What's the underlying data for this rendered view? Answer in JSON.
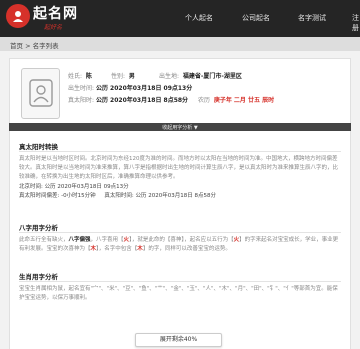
{
  "header": {
    "logo_title": "起名网",
    "logo_sub": "起好名",
    "nav": [
      "个人起名",
      "公司起名",
      "名字测试",
      "注册"
    ]
  },
  "breadcrumb": "首页 > 名字列表",
  "profile": {
    "surname_label": "姓氏:",
    "surname": "陈",
    "gender_label": "性别:",
    "gender": "男",
    "birthplace_label": "出生地:",
    "birthplace": "福建省-厦门市-湖里区",
    "birth_label": "出生时间:",
    "birth_value": "公历 2020年03月18日 09点13分",
    "true_solar_label": "真太阳时:",
    "true_solar_value": "公历 2020年03月18日 8点58分",
    "lunar_label": "农历",
    "lunar_value": "庚子年 二月 廿五 辰时"
  },
  "collapse_label": "收起用字分析 ▼",
  "sections": {
    "s1_title": "真太阳时转换",
    "s1_text": "真太阳时是以当地时区时间。北京时间为东经120度为准的时间。而地方时以太阳在当地的时间为准。中国地大，横跨地方时间偏差较大。真太阳时是以当地时间为准来推算，算八字是指根据时出生地的时间计算生辰八字，是以真太阳时为准来推算生辰八字的，比较准确，在转换为出生地的太阳时区后，准确推算命理以供参考。",
    "s1_row1_label": "北京时间:",
    "s1_row1_value": "公历 2020年03月18日 09点13分",
    "s1_row2_label": "真太阳时间偏差:",
    "s1_row2_value": "-0小时15分钟",
    "s1_row3_label": "真太阳时间:",
    "s1_row3_value": "公历 2020年03月18日 8点58分",
    "s2_title": "八字用字分析",
    "s2_a": "此命五行全有缺火，",
    "s2_b": "八字偏强",
    "s2_c": "，八字喜用【",
    "s2_d": "火",
    "s2_e": "】，就是此命的【喜神】，起名应以五行为【",
    "s2_f": "火",
    "s2_g": "】的字来起名对宝宝成长，学业，事业更有利发展。宝宝的次喜神为【",
    "s2_h": "木",
    "s2_i": "】，名字中包含【",
    "s2_j": "木",
    "s2_k": "】的字，同样可以改善宝宝的运势。",
    "s3_title": "生肖用字分析",
    "s3_text": "宝宝生肖属相为鼠，起名宜有\"宀\"、\"米\"、\"豆\"、\"鱼\"、\"艹\"、\"金\"、\"玉\"、\"人\"、\"木\"、\"月\"、\"田\"、\"钅\"、\"亻\"等部首为宜。能保护宝宝运势，以保万事顺利。"
  },
  "expand_label": "展开剩余40%"
}
